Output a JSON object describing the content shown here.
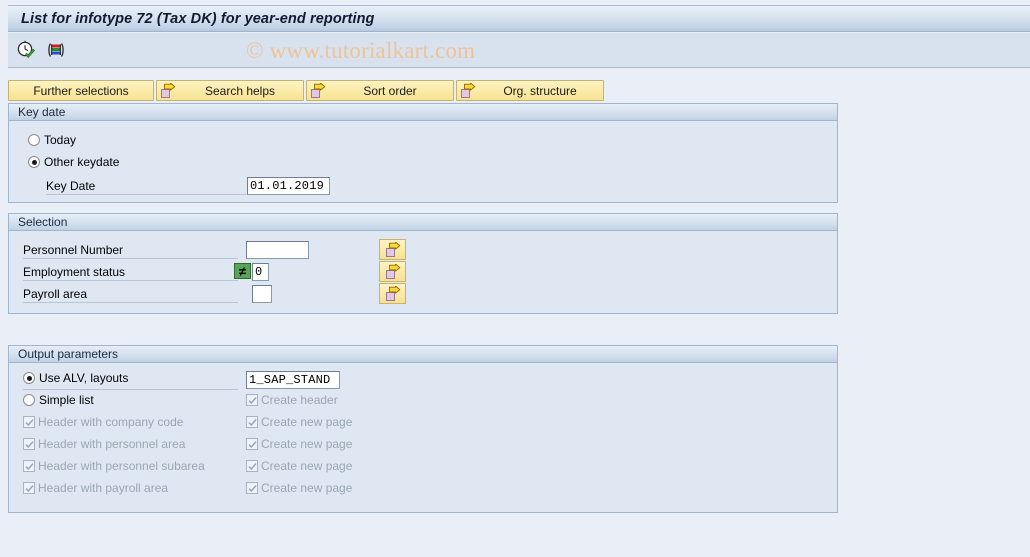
{
  "window": {
    "title": "List for infotype 72 (Tax DK) for year-end reporting"
  },
  "toolbar": {
    "icons": [
      {
        "name": "execute-clock-icon",
        "title": "Execute"
      },
      {
        "name": "variant-bars-icon",
        "title": "Get Variant"
      }
    ],
    "watermark": "© www.tutorialkart.com"
  },
  "action_buttons": [
    {
      "label": "Further selections",
      "icon": null
    },
    {
      "label": "Search helps",
      "icon": "arrow-right-icon"
    },
    {
      "label": "Sort order",
      "icon": "arrow-right-icon"
    },
    {
      "label": "Org. structure",
      "icon": "arrow-right-icon"
    }
  ],
  "key_date": {
    "header": "Key date",
    "options": [
      {
        "label": "Today",
        "selected": false
      },
      {
        "label": "Other keydate",
        "selected": true
      }
    ],
    "field": {
      "label": "Key Date",
      "value": "01.01.2019"
    }
  },
  "selection": {
    "header": "Selection",
    "rows": [
      {
        "label": "Personnel Number",
        "value": "",
        "operator": null,
        "has_arrow": true
      },
      {
        "label": "Employment status",
        "value": "0",
        "operator": "≠",
        "has_arrow": true
      },
      {
        "label": "Payroll area",
        "value": "",
        "operator": null,
        "has_arrow": true
      }
    ]
  },
  "output_parameters": {
    "header": "Output parameters",
    "alv": {
      "label": "Use ALV, layouts",
      "selected": true,
      "layout_value": "1_SAP_STAND"
    },
    "simple_list": {
      "label": "Simple list",
      "selected": false
    },
    "left_checkboxes": [
      {
        "label": "Header with company code",
        "checked": true,
        "disabled": true
      },
      {
        "label": "Header with personnel area",
        "checked": true,
        "disabled": true
      },
      {
        "label": "Header with personnel subarea",
        "checked": true,
        "disabled": true
      },
      {
        "label": "Header with payroll area",
        "checked": true,
        "disabled": true
      }
    ],
    "right_checkboxes": [
      {
        "label": "Create header",
        "checked": true,
        "disabled": true
      },
      {
        "label": "Create new page",
        "checked": true,
        "disabled": true
      },
      {
        "label": "Create new page",
        "checked": true,
        "disabled": true
      },
      {
        "label": "Create new page",
        "checked": true,
        "disabled": true
      },
      {
        "label": "Create new page",
        "checked": true,
        "disabled": true
      }
    ]
  },
  "colors": {
    "background": "#eaeff7",
    "panel_body": "#dfe8f2",
    "panel_border": "#9eb6d0",
    "button_yellow": "#fbeaa4",
    "title_text": "#101b33",
    "watermark": "#f0c396",
    "operator_green": "#5aa45a",
    "disabled_text": "#9aa6b4"
  }
}
